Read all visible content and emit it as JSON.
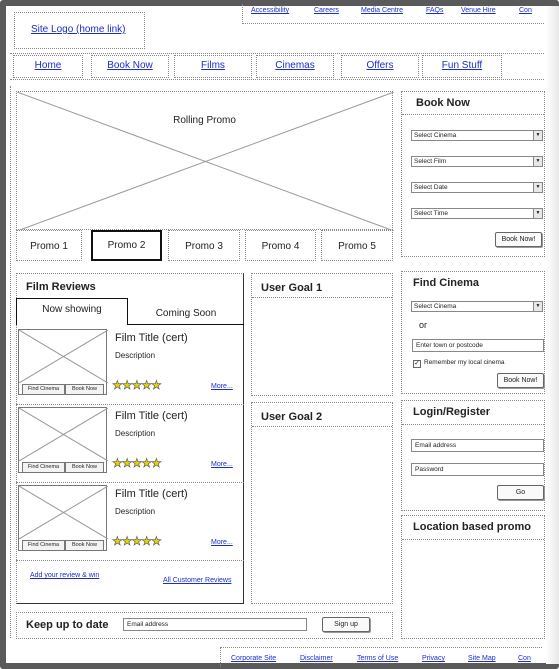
{
  "utility_links": [
    "Accessibility",
    "Careers",
    "Media Centre",
    "FAQs",
    "Venue Hire",
    "Con"
  ],
  "logo": {
    "label": "Site Logo (home link)"
  },
  "nav": [
    "Home",
    "Book Now",
    "Films",
    "Cinemas",
    "Offers",
    "Fun Stuff"
  ],
  "promo": {
    "title": "Rolling Promo",
    "tabs": [
      "Promo 1",
      "Promo 2",
      "Promo 3",
      "Promo 4",
      "Promo 5"
    ],
    "active_tab": "Promo 2"
  },
  "film_reviews": {
    "title": "Film Reviews",
    "tabs": [
      "Now showing",
      "Coming Soon"
    ],
    "items": [
      {
        "title": "Film Title (cert)",
        "description": "Description",
        "find_label": "Find Cinema",
        "book_label": "Book Now",
        "rating": 5,
        "stars": "★★★★★",
        "more": "More..."
      },
      {
        "title": "Film Title (cert)",
        "description": "Description",
        "find_label": "Find Cinema",
        "book_label": "Book Now",
        "rating": 5,
        "stars": "★★★★★",
        "more": "More..."
      },
      {
        "title": "Film Title (cert)",
        "description": "Description",
        "find_label": "Find Cinema",
        "book_label": "Book Now",
        "rating": 5,
        "stars": "★★★★★",
        "more": "More..."
      }
    ],
    "add_review": "Add your review & win",
    "all_reviews": "All Customer Reviews"
  },
  "user_goals": [
    "User Goal 1",
    "User Goal 2"
  ],
  "book_now": {
    "title": "Book Now",
    "selects": [
      "Select Cinema",
      "Select Film",
      "Select Date",
      "Select Time"
    ],
    "button": "Book Now!"
  },
  "find_cinema": {
    "title": "Find Cinema",
    "select": "Select Cinema",
    "or": "or",
    "input_value": "Enter town or postcode",
    "remember_label": "Remember my local cinema",
    "remember_checked": true,
    "check_mark": "✓",
    "button": "Book Now!"
  },
  "login": {
    "title": "Login/Register",
    "email_value": "Email address",
    "password_value": "Password",
    "button": "Go"
  },
  "location_promo": {
    "title": "Location based promo"
  },
  "newsletter": {
    "title": "Keep up to date",
    "input_value": "Email address",
    "button": "Sign up"
  },
  "footer_links": [
    "Corporate Site",
    "Disclaimer",
    "Terms of Use",
    "Privacy",
    "Site Map",
    "Con"
  ],
  "icons": {
    "select_arrow": "▼"
  }
}
